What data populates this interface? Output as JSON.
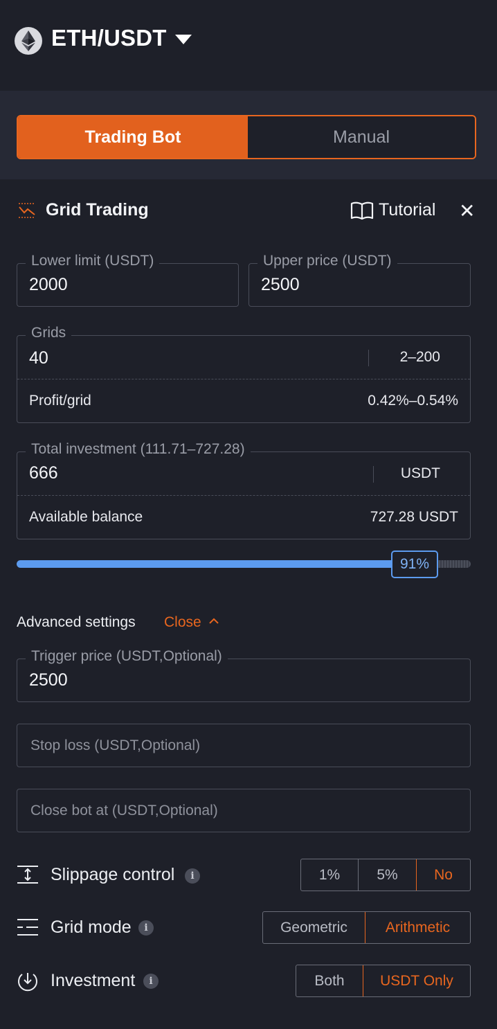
{
  "header": {
    "pair": "ETH/USDT",
    "coin_icon": "ethereum-icon"
  },
  "mode_switch": {
    "active": "Trading Bot",
    "inactive": "Manual"
  },
  "section": {
    "title": "Grid Trading",
    "tutorial": "Tutorial",
    "close_icon": "close-icon"
  },
  "lower_limit": {
    "label": "Lower limit (USDT)",
    "value": "2000"
  },
  "upper_price": {
    "label": "Upper price (USDT)",
    "value": "2500"
  },
  "grids": {
    "label": "Grids",
    "value": "40",
    "range": "2–200",
    "profit_label": "Profit/grid",
    "profit_value": "0.42%–0.54%"
  },
  "investment": {
    "label": "Total investment (111.71–727.28)",
    "value": "666",
    "unit": "USDT",
    "balance_label": "Available balance",
    "balance_value": "727.28 USDT"
  },
  "slider": {
    "percent_label": "91%",
    "fraction": 0.91
  },
  "advanced": {
    "label": "Advanced settings",
    "toggle": "Close"
  },
  "trigger_price": {
    "label": "Trigger price (USDT,Optional)",
    "value": "2500"
  },
  "stop_loss": {
    "placeholder": "Stop loss (USDT,Optional)"
  },
  "close_bot": {
    "placeholder": "Close bot at (USDT,Optional)"
  },
  "slippage": {
    "label": "Slippage control",
    "options": [
      "1%",
      "5%",
      "No"
    ],
    "selected": "No"
  },
  "grid_mode": {
    "label": "Grid mode",
    "options": [
      "Geometric",
      "Arithmetic"
    ],
    "selected": "Arithmetic"
  },
  "investment_mode": {
    "label": "Investment",
    "options": [
      "Both",
      "USDT Only"
    ],
    "selected": "USDT Only"
  },
  "colors": {
    "accent": "#e2611e",
    "slider": "#5c9bef",
    "background": "#1e2029"
  }
}
